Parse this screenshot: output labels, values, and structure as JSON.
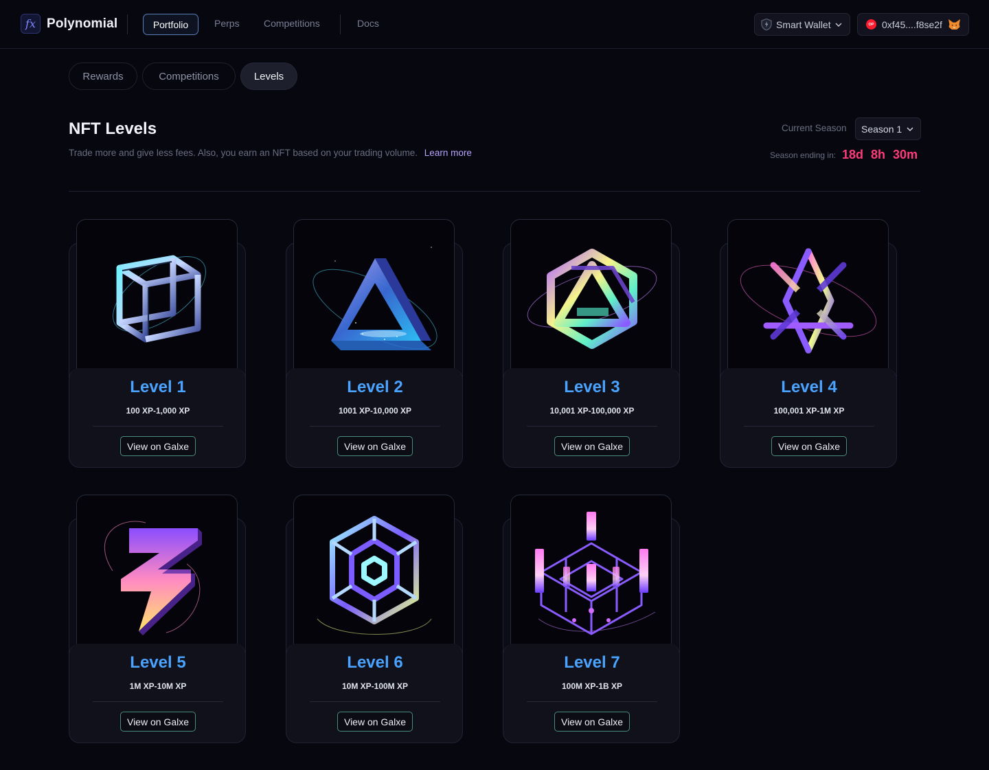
{
  "app": {
    "name": "Polynomial",
    "logo_glyph": "fx"
  },
  "nav": [
    {
      "label": "Portfolio",
      "active": true
    },
    {
      "label": "Perps",
      "active": false
    },
    {
      "label": "Competitions",
      "active": false
    },
    {
      "label": "Docs",
      "active": false
    }
  ],
  "wallet": {
    "label": "Smart Wallet",
    "icon": "shield-icon"
  },
  "account": {
    "address": "0xf45....f8se2f",
    "network_badge": "OP",
    "wallet_icon": "metamask-fox-icon"
  },
  "tabs": [
    {
      "label": "Rewards",
      "active": false
    },
    {
      "label": "Competitions",
      "active": false
    },
    {
      "label": "Levels",
      "active": true
    }
  ],
  "page": {
    "title": "NFT Levels",
    "description": "Trade more and give less fees. Also, you earn an NFT based on your trading volume.",
    "learn_more": "Learn more"
  },
  "season": {
    "label": "Current Season",
    "selected": "Season 1",
    "ending_label": "Season ending in:",
    "days": "18d",
    "hours": "8h",
    "minutes": "30m"
  },
  "levels": [
    {
      "name": "Level 1",
      "xp": "100 XP-1,000 XP",
      "button": "View on Galxe",
      "art": "impossible-cube"
    },
    {
      "name": "Level 2",
      "xp": "1001 XP-10,000 XP",
      "button": "View on Galxe",
      "art": "penrose-triangle"
    },
    {
      "name": "Level 3",
      "xp": "10,001 XP-100,000 XP",
      "button": "View on Galxe",
      "art": "interlocked-hexagon"
    },
    {
      "name": "Level 4",
      "xp": "100,001 XP-1M XP",
      "button": "View on Galxe",
      "art": "star-weave"
    },
    {
      "name": "Level 5",
      "xp": "1M XP-10M XP",
      "button": "View on Galxe",
      "art": "lightning-bolt"
    },
    {
      "name": "Level 6",
      "xp": "10M XP-100M XP",
      "button": "View on Galxe",
      "art": "hex-maze"
    },
    {
      "name": "Level 7",
      "xp": "100M XP-1B XP",
      "button": "View on Galxe",
      "art": "crystal-lattice"
    }
  ],
  "colors": {
    "background": "#07070f",
    "level_title": "#4aa3ff",
    "countdown": "#ff3b7a",
    "link": "#b7a5ff",
    "active_nav_border": "#5a7fb6"
  }
}
